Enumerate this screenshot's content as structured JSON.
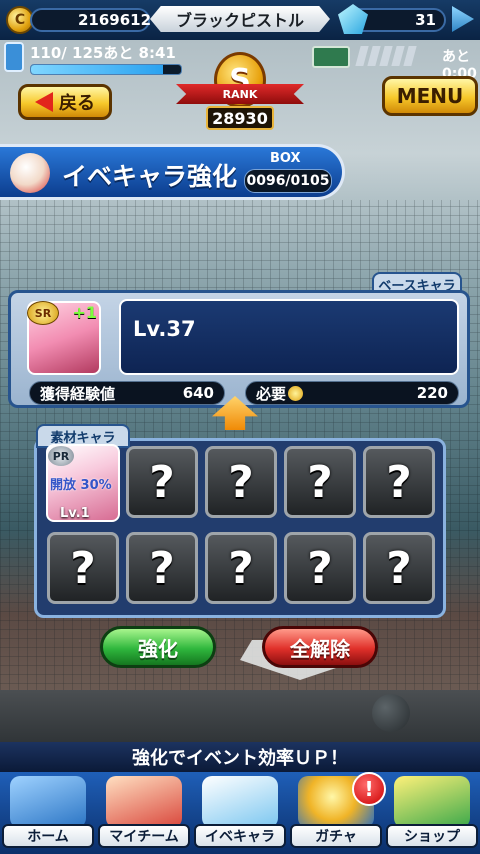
{
  "top": {
    "coins": "2169612",
    "coin_icon": "coin-icon",
    "player_name": "ブラックピストル",
    "gems": "31",
    "gem_icon": "diamond-icon"
  },
  "stamina": {
    "text": "110/ 125あと  8:41",
    "current": 110,
    "max": 125
  },
  "tickets": {
    "time": "あと  0:00"
  },
  "rank": {
    "grade": "S",
    "label": "RANK",
    "score": "28930"
  },
  "nav_buttons": {
    "back_label": "戻る",
    "menu_label": "MENU"
  },
  "header": {
    "title": "イベキャラ強化",
    "box_label": "BOX",
    "box_value": "0096/0105"
  },
  "base": {
    "tab_label": "ベースキャラ",
    "rarity": "SR",
    "plus": "+1",
    "level": "Lv.37",
    "exp_label": "獲得経験値",
    "exp_value": "640",
    "need_label": "必要",
    "need_value": "220"
  },
  "material": {
    "tab_label": "素材キャラ",
    "card": {
      "rarity": "PR",
      "open_text": "開放 30%",
      "level": "Lv.1"
    },
    "empty_slot_mark": "?"
  },
  "actions": {
    "strengthen_label": "強化",
    "release_label": "全解除"
  },
  "banner": "強化でイベント効率ＵＰ！",
  "bottom_nav": [
    {
      "label": "ホーム",
      "icon": "home-icon"
    },
    {
      "label": "マイチーム",
      "icon": "team-icon"
    },
    {
      "label": "イベキャラ",
      "icon": "event-character-icon"
    },
    {
      "label": "ガチャ",
      "icon": "gacha-icon"
    },
    {
      "label": "ショップ",
      "icon": "shop-icon"
    }
  ],
  "alert_mark": "!"
}
